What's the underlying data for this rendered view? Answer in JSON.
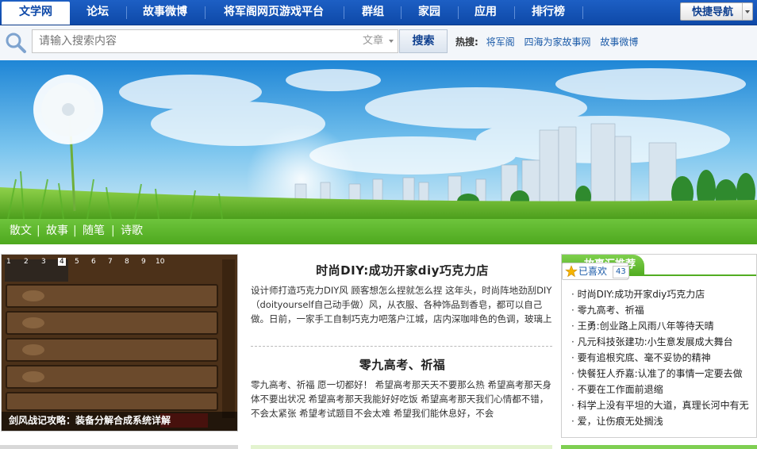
{
  "nav": {
    "tabs": [
      {
        "label": "文学网",
        "active": true
      },
      {
        "label": "论坛"
      },
      {
        "label": "故事微博"
      },
      {
        "label": "将军阁网页游戏平台"
      },
      {
        "label": "群组"
      },
      {
        "label": "家园"
      },
      {
        "label": "应用"
      },
      {
        "label": "排行榜"
      }
    ],
    "quick_nav_label": "快捷导航"
  },
  "search": {
    "placeholder": "请输入搜索内容",
    "type_selected": "文章",
    "button_label": "搜索",
    "hot_label": "热搜:",
    "hot_keywords": [
      "将军阁",
      "四海为家故事网",
      "故事微博"
    ]
  },
  "categories": [
    "散文",
    "故事",
    "随笔",
    "诗歌"
  ],
  "slider": {
    "pages": [
      "1",
      "2",
      "3",
      "4",
      "5",
      "6",
      "7",
      "8",
      "9",
      "10"
    ],
    "active_page": 4,
    "caption": "剑风战记攻略：装备分解合成系统详解"
  },
  "articles": [
    {
      "title": "时尚DIY:成功开家diy巧克力店",
      "summary": "设计师打造巧克力DIY风 顾客想怎么捏就怎么捏 这年头，时尚阵地劲刮DIY（doityourself自己动手做）风，从衣服、各种饰品到香皂，都可以自己做。日前，一家手工自制巧克力吧落户江城，店内深咖啡色的色调，玻璃上"
    },
    {
      "title": "零九高考、祈福",
      "summary": "零九高考、祈福 愿一切都好！ 希望高考那天天不要那么热 希望高考那天身体不要出状况 希望高考那天我能好好吃饭 希望高考那天我们心情都不错，不会太紧张 希望考试题目不会太难 希望我们能休息好，不会"
    }
  ],
  "panel": {
    "tab_label": "故事汇推荐",
    "like_label": "已喜欢",
    "like_count": "43",
    "items": [
      "时尚DIY:成功开家diy巧克力店",
      "零九高考、祈福",
      "王勇:创业路上风雨八年等待天晴",
      "凡元科技张建功:小生意发展成大舞台",
      "要有追根究底、毫不妥协的精神",
      "快餐狂人乔嘉:认准了的事情一定要去做",
      "不要在工作面前退缩",
      "科学上没有平坦的大道，真理长河中有无",
      "爱，让伤痕无处搁浅"
    ]
  },
  "colors": {
    "nav_blue": "#0e49a8",
    "category_green": "#4ea81e",
    "link_blue": "#1a5aa8"
  }
}
